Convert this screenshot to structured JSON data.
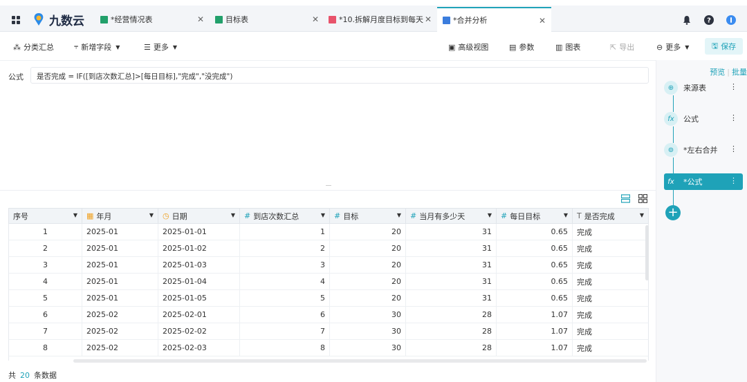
{
  "brand": {
    "name": "九数云"
  },
  "tabs": [
    {
      "label": "*经营情况表",
      "icon": "sheet-icon",
      "color": "#22a06b",
      "active": false
    },
    {
      "label": "目标表",
      "icon": "sheet-icon",
      "color": "#22a06b",
      "active": false
    },
    {
      "label": "*10.拆解月度目标到每天",
      "icon": "analysis-icon",
      "color": "#e8536b",
      "active": false
    },
    {
      "label": "*合并分析",
      "icon": "chart-icon",
      "color": "#3b7ddd",
      "active": true
    }
  ],
  "toolbar": {
    "group_summary": "分类汇总",
    "add_field": "新增字段",
    "more_left": "更多",
    "advanced_view": "高级视图",
    "params": "参数",
    "chart": "图表",
    "export": "导出",
    "more_right": "更多",
    "save": "保存"
  },
  "formula": {
    "label": "公式",
    "expression": "是否完成 = IF([到店次数汇总]>[每日目标],\"完成\",\"没完成\")"
  },
  "table": {
    "columns": [
      {
        "label": "序号",
        "type": ""
      },
      {
        "label": "年月",
        "type": "date"
      },
      {
        "label": "日期",
        "type": "time"
      },
      {
        "label": "到店次数汇总",
        "type": "#"
      },
      {
        "label": "目标",
        "type": "#"
      },
      {
        "label": "当月有多少天",
        "type": "#"
      },
      {
        "label": "每日目标",
        "type": "#"
      },
      {
        "label": "是否完成",
        "type": "T"
      }
    ],
    "rows": [
      [
        "1",
        "2025-01",
        "2025-01-01",
        "1",
        "20",
        "31",
        "0.65",
        "完成"
      ],
      [
        "2",
        "2025-01",
        "2025-01-02",
        "2",
        "20",
        "31",
        "0.65",
        "完成"
      ],
      [
        "3",
        "2025-01",
        "2025-01-03",
        "3",
        "20",
        "31",
        "0.65",
        "完成"
      ],
      [
        "4",
        "2025-01",
        "2025-01-04",
        "4",
        "20",
        "31",
        "0.65",
        "完成"
      ],
      [
        "5",
        "2025-01",
        "2025-01-05",
        "5",
        "20",
        "31",
        "0.65",
        "完成"
      ],
      [
        "6",
        "2025-02",
        "2025-02-01",
        "6",
        "30",
        "28",
        "1.07",
        "完成"
      ],
      [
        "7",
        "2025-02",
        "2025-02-02",
        "7",
        "30",
        "28",
        "1.07",
        "完成"
      ],
      [
        "8",
        "2025-02",
        "2025-02-03",
        "8",
        "30",
        "28",
        "1.07",
        "完成"
      ]
    ]
  },
  "footer": {
    "prefix": "共",
    "count": "20",
    "suffix": "条数据"
  },
  "right_panel": {
    "preview": "预览",
    "batch": "批量",
    "steps": [
      {
        "label": "来源表",
        "icon": "source-icon",
        "active": false
      },
      {
        "label": "公式",
        "icon": "fx-icon",
        "active": false
      },
      {
        "label": "*左右合并",
        "icon": "merge-icon",
        "active": false
      },
      {
        "label": "*公式",
        "icon": "fx-icon",
        "active": true
      }
    ]
  },
  "colors": {
    "accent": "#1fa2b8",
    "tab_bar": "#f3f5f8"
  }
}
